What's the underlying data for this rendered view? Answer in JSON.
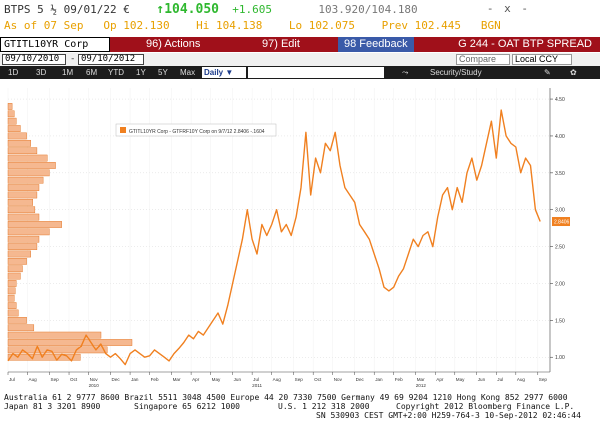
{
  "quote": {
    "ticker": "BTPS 5",
    "fraction": "½",
    "maturity": "09/01/22 €",
    "last": "104.050",
    "change": "+1.605",
    "bid_ask": "103.920/104.180",
    "controls": "- x -",
    "asof": "As of 07 Sep",
    "open": "Op 102.130",
    "high": "Hi 104.138",
    "low": "Lo 102.075",
    "prev": "Prev 102.445",
    "source": "BGN"
  },
  "toolbar": {
    "security": "GTITL10YR Corp",
    "actions": "96) Actions",
    "edit": "97) Edit",
    "feedback": "98 Feedback",
    "title": "G 244 - OAT BTP SPREAD"
  },
  "dates": {
    "start": "09/10/2010",
    "end": "09/10/2012",
    "compare": "Compare",
    "currency": "Local CCY",
    "security_study": "Security/Study"
  },
  "ranges": {
    "items": [
      "1D",
      "3D",
      "1M",
      "6M",
      "YTD",
      "1Y",
      "5Y",
      "Max"
    ],
    "frequency": "Daily"
  },
  "colors": {
    "line": "#f08020",
    "bars": "#f5b890",
    "bar_edge": "#e06810",
    "axis": "#444444"
  },
  "chart_data": {
    "type": "line",
    "legend": "GTITL10YR Corp - GTFRF10Y Corp on 9/7/12 2.8406 -.1604",
    "last_label": "2.8406",
    "y_ticks": [
      1.0,
      1.5,
      2.0,
      2.5,
      3.0,
      3.5,
      4.0,
      4.5
    ],
    "y_tick_labels": [
      "1.00",
      "1.50",
      "2.00",
      "2.50",
      "3.00",
      "3.50",
      "4.00",
      "4.50"
    ],
    "ylim": [
      0.8,
      4.65
    ],
    "x_ticks": [
      {
        "month": "Jul",
        "t": 2010.5
      },
      {
        "month": "Aug",
        "t": 2010.58
      },
      {
        "month": "Sep",
        "t": 2010.67
      },
      {
        "month": "Oct",
        "t": 2010.75
      },
      {
        "month": "Nov",
        "t": 2010.83
      },
      {
        "month": "Dec",
        "t": 2010.92
      },
      {
        "month": "Jan",
        "t": 2011.0
      },
      {
        "month": "Feb",
        "t": 2011.08
      },
      {
        "month": "Mar",
        "t": 2011.17
      },
      {
        "month": "Apr",
        "t": 2011.25
      },
      {
        "month": "May",
        "t": 2011.33
      },
      {
        "month": "Jun",
        "t": 2011.42
      },
      {
        "month": "Jul",
        "t": 2011.5
      },
      {
        "month": "Aug",
        "t": 2011.58
      },
      {
        "month": "Sep",
        "t": 2011.67
      },
      {
        "month": "Oct",
        "t": 2011.75
      },
      {
        "month": "Nov",
        "t": 2011.83
      },
      {
        "month": "Dec",
        "t": 2011.92
      },
      {
        "month": "Jan",
        "t": 2012.0
      },
      {
        "month": "Feb",
        "t": 2012.08
      },
      {
        "month": "Mar",
        "t": 2012.17
      },
      {
        "month": "Apr",
        "t": 2012.25
      },
      {
        "month": "May",
        "t": 2012.33
      },
      {
        "month": "Jun",
        "t": 2012.42
      },
      {
        "month": "Jul",
        "t": 2012.5
      },
      {
        "month": "Aug",
        "t": 2012.58
      },
      {
        "month": "Sep",
        "t": 2012.67
      }
    ],
    "year_labels": [
      {
        "label": "2010",
        "t": 2010.83
      },
      {
        "label": "2011",
        "t": 2011.5
      },
      {
        "label": "2012",
        "t": 2012.17
      }
    ],
    "xlim": [
      2010.5,
      2012.72
    ],
    "series": [
      {
        "t": [
          2010.5,
          2010.52,
          2010.54,
          2010.56,
          2010.58,
          2010.6,
          2010.62,
          2010.64,
          2010.66,
          2010.68,
          2010.7,
          2010.72,
          2010.74,
          2010.76,
          2010.78,
          2010.8,
          2010.82,
          2010.84,
          2010.86,
          2010.88,
          2010.9,
          2010.92,
          2010.94,
          2010.96,
          2010.98,
          2011.0,
          2011.02,
          2011.04,
          2011.06,
          2011.08,
          2011.1,
          2011.12,
          2011.14,
          2011.16,
          2011.18,
          2011.2,
          2011.22,
          2011.24,
          2011.26,
          2011.28,
          2011.3,
          2011.32,
          2011.34,
          2011.36,
          2011.38,
          2011.4,
          2011.42,
          2011.44,
          2011.46,
          2011.48,
          2011.5,
          2011.52,
          2011.54,
          2011.56,
          2011.58,
          2011.6,
          2011.62,
          2011.64,
          2011.66,
          2011.68,
          2011.7,
          2011.72,
          2011.74,
          2011.76,
          2011.78,
          2011.8,
          2011.82,
          2011.84,
          2011.86,
          2011.88,
          2011.9,
          2011.92,
          2011.94,
          2011.96,
          2011.98,
          2012.0,
          2012.02,
          2012.04,
          2012.06,
          2012.08,
          2012.1,
          2012.12,
          2012.14,
          2012.16,
          2012.18,
          2012.2,
          2012.22,
          2012.24,
          2012.26,
          2012.28,
          2012.3,
          2012.32,
          2012.34,
          2012.36,
          2012.38,
          2012.4,
          2012.42,
          2012.44,
          2012.46,
          2012.48,
          2012.5,
          2012.52,
          2012.54,
          2012.56,
          2012.58,
          2012.6,
          2012.62,
          2012.64,
          2012.66,
          2012.68
        ],
        "values": [
          0.95,
          1.05,
          1.0,
          1.1,
          1.05,
          0.98,
          1.15,
          1.0,
          1.1,
          1.08,
          0.96,
          1.04,
          1.02,
          0.95,
          1.1,
          1.15,
          1.3,
          1.2,
          1.1,
          1.18,
          1.05,
          1.0,
          1.05,
          0.98,
          0.9,
          1.05,
          1.1,
          1.05,
          1.0,
          1.02,
          1.1,
          1.05,
          1.0,
          0.95,
          1.05,
          1.12,
          1.2,
          1.3,
          1.25,
          1.35,
          1.3,
          1.4,
          1.5,
          1.6,
          1.45,
          1.7,
          2.0,
          2.3,
          2.6,
          3.0,
          2.6,
          2.4,
          2.8,
          2.65,
          2.8,
          3.0,
          2.7,
          2.8,
          2.65,
          2.9,
          3.3,
          4.05,
          3.2,
          3.7,
          3.5,
          3.9,
          3.8,
          4.05,
          3.6,
          3.3,
          3.2,
          3.1,
          2.8,
          2.7,
          2.6,
          2.4,
          2.2,
          1.95,
          1.9,
          1.95,
          2.1,
          2.2,
          2.4,
          2.6,
          2.5,
          2.65,
          2.7,
          2.5,
          2.9,
          3.2,
          3.3,
          3.0,
          3.3,
          3.1,
          3.5,
          3.7,
          3.4,
          3.6,
          3.9,
          4.2,
          3.7,
          4.35,
          4.0,
          3.9,
          3.85,
          3.5,
          3.7,
          3.6,
          3.0,
          2.84
        ]
      }
    ],
    "distribution": {
      "levels": [
        1.0,
        1.1,
        1.2,
        1.3,
        1.4,
        1.5,
        1.6,
        1.7,
        1.8,
        1.9,
        2.0,
        2.1,
        2.2,
        2.3,
        2.4,
        2.5,
        2.6,
        2.7,
        2.8,
        2.9,
        3.0,
        3.1,
        3.2,
        3.3,
        3.4,
        3.5,
        3.6,
        3.7,
        3.8,
        3.9,
        4.0,
        4.1,
        4.2,
        4.3,
        4.4
      ],
      "counts": [
        70,
        96,
        120,
        90,
        25,
        18,
        10,
        8,
        6,
        7,
        8,
        12,
        14,
        18,
        22,
        28,
        30,
        40,
        52,
        30,
        26,
        24,
        28,
        30,
        34,
        40,
        46,
        38,
        28,
        22,
        18,
        12,
        8,
        6,
        4
      ]
    }
  },
  "footer": {
    "line1": "Australia 61 2 9777 8600 Brazil 5511 3048 4500 Europe 44 20 7330 7500 Germany 49 69 9204 1210 Hong Kong 852 2977 6000",
    "line2a": "Japan 81 3 3201 8900",
    "line2b": "Singapore 65 6212 1000",
    "line2c": "U.S. 1 212 318 2000",
    "line2d": "Copyright 2012 Bloomberg Finance L.P.",
    "line3": "SN 530903 CEST GMT+2:00 H259-764-3 10-Sep-2012 02:46:44"
  }
}
